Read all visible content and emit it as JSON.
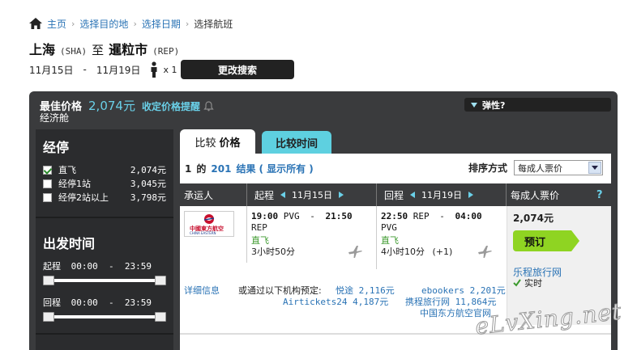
{
  "breadcrumb": {
    "home": "主页",
    "step1": "选择目的地",
    "step2": "选择日期",
    "step3": "选择航班"
  },
  "route": {
    "origin": "上海",
    "origin_code": "(SHA)",
    "connector": "至",
    "destination": "暹粒市",
    "destination_code": "(REP)"
  },
  "trip": {
    "depart": "11月15日",
    "dash": "-",
    "return": "11月19日",
    "pax": "x 1",
    "change_button": "更改搜索"
  },
  "summary": {
    "best_price_label": "最佳价格",
    "best_price": "2,074元",
    "alert_label": "收定价格提醒",
    "cabin": "经济舱",
    "elastic_label": "弹性?"
  },
  "sidebar": {
    "stops_title": "经停",
    "stops": [
      {
        "label": "直飞",
        "price": "2,074元",
        "checked": true
      },
      {
        "label": "经停1站",
        "price": "3,045元",
        "checked": false
      },
      {
        "label": "经停2站以上",
        "price": "3,798元",
        "checked": false
      }
    ],
    "time_title": "出发时间",
    "out_time": {
      "label": "起程",
      "range": "00:00  -  23:59"
    },
    "ret_time": {
      "label": "回程",
      "range": "00:00  -  23:59"
    }
  },
  "tabs": {
    "price_prefix": "比较",
    "price": "价格",
    "time": "比较时间"
  },
  "results": {
    "start": "1",
    "of": "的",
    "total": "201",
    "label": "结果",
    "show_all": "( 显示所有 )",
    "sort_label": "排序方式",
    "sort_value": "每成人票价"
  },
  "columns": {
    "carrier": "承运人",
    "outbound": "起程",
    "outbound_date": "11月15日",
    "return": "回程",
    "return_date": "11月19日",
    "per_adult": "每成人票价",
    "help": "?"
  },
  "flight": {
    "airline_logo_text": "中國東方航空",
    "airline_logo_sub": "CHINA EASTERN",
    "out": {
      "dep": "19:00",
      "dep_code": "PVG",
      "dash": "-",
      "arr": "21:50",
      "arr_code": "REP",
      "stops": "直飞",
      "duration": "3小时50分"
    },
    "ret": {
      "dep": "22:50",
      "dep_code": "REP",
      "dash": "-",
      "arr": "04:00",
      "arr_code": "PVG",
      "stops": "直飞",
      "duration": "4小时10分",
      "plus": "(+1)"
    },
    "price": "2,074元",
    "book": "预订",
    "agent": "乐程旅行网",
    "realtime": "实时",
    "details": "详细信息",
    "alt_label": "或通过以下机构预定:",
    "alts": [
      "悦途 2,116元",
      "ebookers 2,201元",
      "Airtickets24 4,187元",
      "携程旅行网 11,864元",
      "中国东方航空官网"
    ]
  },
  "watermark": "eLvXing.net",
  "colors": {
    "accent": "#6ad0e8",
    "link": "#2a73b5",
    "book": "#8fd422",
    "frame": "#3a3b3d"
  }
}
